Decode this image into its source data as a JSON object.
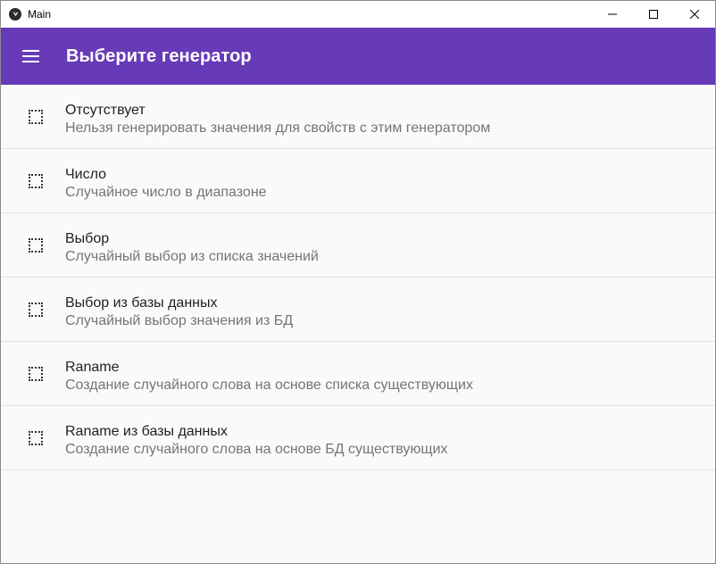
{
  "window": {
    "title": "Main"
  },
  "appbar": {
    "title": "Выберите генератор"
  },
  "generators": [
    {
      "title": "Отсутствует",
      "description": "Нельзя генерировать значения для свойств с этим генератором"
    },
    {
      "title": "Число",
      "description": "Случайное число в диапазоне"
    },
    {
      "title": "Выбор",
      "description": "Случайный выбор из списка значений"
    },
    {
      "title": "Выбор из базы данных",
      "description": "Случайный выбор значения из БД"
    },
    {
      "title": "Raname",
      "description": "Создание случайного слова на основе списка существующих"
    },
    {
      "title": "Raname из базы данных",
      "description": "Создание случайного слова на основе БД существующих"
    }
  ],
  "colors": {
    "appbar": "#673ab7",
    "background": "#fafafa",
    "primary_text": "#212121",
    "secondary_text": "#757575"
  }
}
